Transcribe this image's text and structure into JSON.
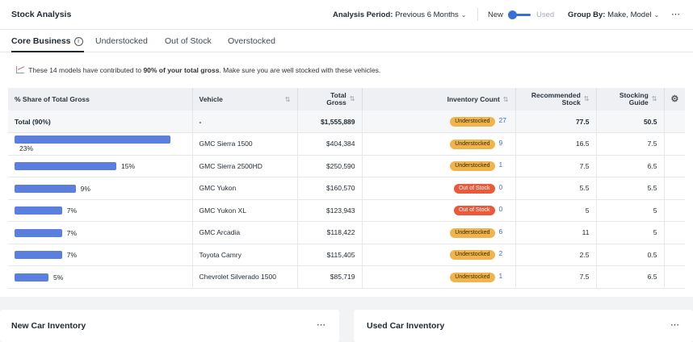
{
  "header": {
    "title": "Stock Analysis",
    "period_label": "Analysis Period:",
    "period_value": "Previous 6 Months",
    "toggle_new": "New",
    "toggle_used": "Used",
    "groupby_label": "Group By:",
    "groupby_value": "Make, Model",
    "more_icon": "more-horizontal-icon"
  },
  "tabs": [
    {
      "label": "Core Business",
      "active": true
    },
    {
      "label": "Understocked",
      "active": false
    },
    {
      "label": "Out of Stock",
      "active": false
    },
    {
      "label": "Overstocked",
      "active": false
    }
  ],
  "notice": {
    "pre": " These 14 models have contributed to ",
    "bold": "90% of your total gross",
    "post": ". Make sure you are well stocked with these vehicles."
  },
  "table": {
    "columns": {
      "share": "% Share of Total Gross",
      "vehicle": "Vehicle",
      "gross": "Total Gross",
      "inventory": "Inventory Count",
      "recommended": "Recommended Stock",
      "guide": "Stocking Guide"
    },
    "total": {
      "label": "Total (90%)",
      "vehicle": "-",
      "gross": "$1,555,889",
      "status": "Understocked",
      "count": "27",
      "recommended": "77.5",
      "guide": "50.5"
    },
    "rows": [
      {
        "share": 23,
        "share_label": "23%",
        "vehicle": "GMC Sierra 1500",
        "gross": "$404,384",
        "status": "Understocked",
        "count": "9",
        "recommended": "16.5",
        "guide": "7.5"
      },
      {
        "share": 15,
        "share_label": "15%",
        "vehicle": "GMC Sierra 2500HD",
        "gross": "$250,590",
        "status": "Understocked",
        "count": "1",
        "recommended": "7.5",
        "guide": "6.5"
      },
      {
        "share": 9,
        "share_label": "9%",
        "vehicle": "GMC Yukon",
        "gross": "$160,570",
        "status": "Out of Stock",
        "count": "0",
        "recommended": "5.5",
        "guide": "5.5"
      },
      {
        "share": 7,
        "share_label": "7%",
        "vehicle": "GMC Yukon XL",
        "gross": "$123,943",
        "status": "Out of Stock",
        "count": "0",
        "recommended": "5",
        "guide": "5"
      },
      {
        "share": 7,
        "share_label": "7%",
        "vehicle": "GMC Arcadia",
        "gross": "$118,422",
        "status": "Understocked",
        "count": "6",
        "recommended": "11",
        "guide": "5"
      },
      {
        "share": 7,
        "share_label": "7%",
        "vehicle": "Toyota Camry",
        "gross": "$115,405",
        "status": "Understocked",
        "count": "2",
        "recommended": "2.5",
        "guide": "0.5"
      },
      {
        "share": 5,
        "share_label": "5%",
        "vehicle": "Chevrolet Silverado 1500",
        "gross": "$85,719",
        "status": "Understocked",
        "count": "1",
        "recommended": "7.5",
        "guide": "6.5"
      }
    ]
  },
  "panels": {
    "new_title": "New Car Inventory",
    "used_title": "Used Car Inventory"
  },
  "colors": {
    "accent": "#3b6fd8",
    "bar": "#5b7fdf",
    "understocked": "#f0b44d",
    "out_of_stock": "#e9593a"
  }
}
